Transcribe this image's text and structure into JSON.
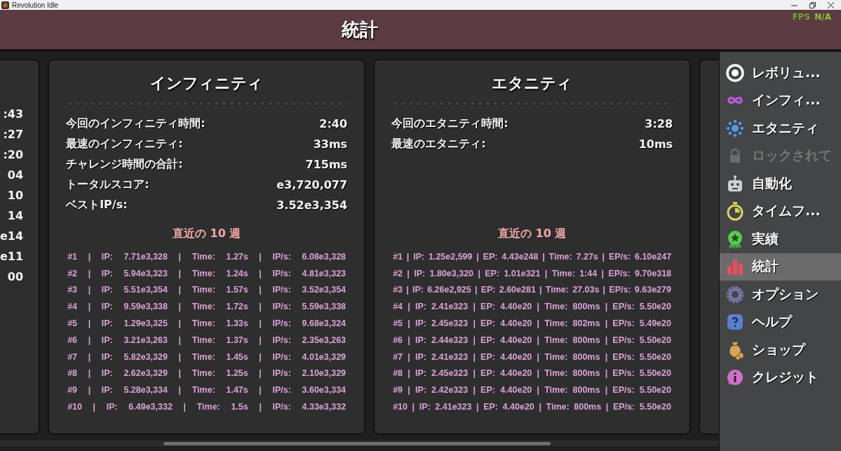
{
  "titlebar": {
    "title": "Revolution Idle"
  },
  "overlay": {
    "fps_label": "FPS",
    "fps_value": "N/A"
  },
  "header": {
    "title": "統計"
  },
  "partial_card": {
    "values": [
      ":43",
      ":27",
      ":20",
      "04",
      "10",
      "14",
      "e14",
      "e11",
      "00"
    ]
  },
  "cards": [
    {
      "title": "インフィニティ",
      "stats": [
        {
          "label": "今回のインフィニティ時間:",
          "value": "2:40"
        },
        {
          "label": "最速のインフィニティ:",
          "value": "33ms"
        },
        {
          "label": "チャレンジ時間の合計:",
          "value": "715ms"
        },
        {
          "label": "トータルスコア:",
          "value": "e3,720,077"
        },
        {
          "label": "ベストIP/s:",
          "value": "3.52e3,354"
        }
      ],
      "recent_heading": "直近の 10 週",
      "runs": [
        {
          "cells": [
            "#1",
            "|",
            "IP:",
            "7.71e3,328",
            "|",
            "Time:",
            "1.27s",
            "|",
            "IP/s:",
            "6.08e3,328"
          ]
        },
        {
          "cells": [
            "#2",
            "|",
            "IP:",
            "5.94e3,323",
            "|",
            "Time:",
            "1.24s",
            "|",
            "IP/s:",
            "4.81e3,323"
          ]
        },
        {
          "cells": [
            "#3",
            "|",
            "IP:",
            "5.51e3,354",
            "|",
            "Time:",
            "1.57s",
            "|",
            "IP/s:",
            "3.52e3,354"
          ]
        },
        {
          "cells": [
            "#4",
            "|",
            "IP:",
            "9.59e3,338",
            "|",
            "Time:",
            "1.72s",
            "|",
            "IP/s:",
            "5.59e3,338"
          ]
        },
        {
          "cells": [
            "#5",
            "|",
            "IP:",
            "1.29e3,325",
            "|",
            "Time:",
            "1.33s",
            "|",
            "IP/s:",
            "9.68e3,324"
          ]
        },
        {
          "cells": [
            "#6",
            "|",
            "IP:",
            "3.21e3,263",
            "|",
            "Time:",
            "1.37s",
            "|",
            "IP/s:",
            "2.35e3,263"
          ]
        },
        {
          "cells": [
            "#7",
            "|",
            "IP:",
            "5.82e3,329",
            "|",
            "Time:",
            "1.45s",
            "|",
            "IP/s:",
            "4.01e3,329"
          ]
        },
        {
          "cells": [
            "#8",
            "|",
            "IP:",
            "2.62e3,329",
            "|",
            "Time:",
            "1.25s",
            "|",
            "IP/s:",
            "2.10e3,329"
          ]
        },
        {
          "cells": [
            "#9",
            "|",
            "IP:",
            "5.28e3,334",
            "|",
            "Time:",
            "1.47s",
            "|",
            "IP/s:",
            "3.60e3,334"
          ]
        },
        {
          "cells": [
            "#10",
            "|",
            "IP:",
            "6.49e3,332",
            "|",
            "Time:",
            "1.5s",
            "|",
            "IP/s:",
            "4.33e3,332"
          ]
        }
      ]
    },
    {
      "title": "エタニティ",
      "stats": [
        {
          "label": "今回のエタニティ時間:",
          "value": "3:28"
        },
        {
          "label": "最速のエタニティ:",
          "value": "10ms"
        }
      ],
      "recent_heading": "直近の 10 週",
      "runs": [
        {
          "cells": [
            "#1",
            "|",
            "IP:",
            "1.25e2,599",
            "|",
            "EP:",
            "4.43e248",
            "|",
            "Time:",
            "7.27s",
            "|",
            "EP/s:",
            "6.10e247"
          ]
        },
        {
          "cells": [
            "#2",
            "|",
            "IP:",
            "1.80e3,320",
            "|",
            "EP:",
            "1.01e321",
            "|",
            "Time:",
            "1:44",
            "|",
            "EP/s:",
            "9.70e318"
          ]
        },
        {
          "cells": [
            "#3",
            "|",
            "IP:",
            "6.26e2,925",
            "|",
            "EP:",
            "2.60e281",
            "|",
            "Time:",
            "27.03s",
            "|",
            "EP/s:",
            "9.63e279"
          ]
        },
        {
          "cells": [
            "#4",
            "|",
            "IP:",
            "2.41e323",
            "|",
            "EP:",
            "4.40e20",
            "|",
            "Time:",
            "800ms",
            "|",
            "EP/s:",
            "5.50e20"
          ]
        },
        {
          "cells": [
            "#5",
            "|",
            "IP:",
            "2.45e323",
            "|",
            "EP:",
            "4.40e20",
            "|",
            "Time:",
            "802ms",
            "|",
            "EP/s:",
            "5.49e20"
          ]
        },
        {
          "cells": [
            "#6",
            "|",
            "IP:",
            "2.44e323",
            "|",
            "EP:",
            "4.40e20",
            "|",
            "Time:",
            "800ms",
            "|",
            "EP/s:",
            "5.50e20"
          ]
        },
        {
          "cells": [
            "#7",
            "|",
            "IP:",
            "2.41e323",
            "|",
            "EP:",
            "4.40e20",
            "|",
            "Time:",
            "800ms",
            "|",
            "EP/s:",
            "5.50e20"
          ]
        },
        {
          "cells": [
            "#8",
            "|",
            "IP:",
            "2.45e323",
            "|",
            "EP:",
            "4.40e20",
            "|",
            "Time:",
            "800ms",
            "|",
            "EP/s:",
            "5.50e20"
          ]
        },
        {
          "cells": [
            "#9",
            "|",
            "IP:",
            "2.42e323",
            "|",
            "EP:",
            "4.40e20",
            "|",
            "Time:",
            "800ms",
            "|",
            "EP/s:",
            "5.50e20"
          ]
        },
        {
          "cells": [
            "#10",
            "|",
            "IP:",
            "2.41e323",
            "|",
            "EP:",
            "4.40e20",
            "|",
            "Time:",
            "800ms",
            "|",
            "EP/s:",
            "5.50e20"
          ]
        }
      ]
    }
  ],
  "sidebar": {
    "items": [
      {
        "label": "レボリュ...",
        "kind": "target",
        "selected": false,
        "locked": false
      },
      {
        "label": "インフィ...",
        "kind": "infinity",
        "selected": false,
        "locked": false
      },
      {
        "label": "エタニティ",
        "kind": "dots",
        "selected": false,
        "locked": false
      },
      {
        "label": "ロックされて",
        "kind": "lock",
        "selected": false,
        "locked": true
      },
      {
        "label": "自動化",
        "kind": "robot",
        "selected": false,
        "locked": false
      },
      {
        "label": "タイムフ...",
        "kind": "stopwatch",
        "selected": false,
        "locked": false
      },
      {
        "label": "実績",
        "kind": "medal",
        "selected": false,
        "locked": false
      },
      {
        "label": "統計",
        "kind": "chart",
        "selected": true,
        "locked": false
      },
      {
        "label": "オプション",
        "kind": "gear",
        "selected": false,
        "locked": false
      },
      {
        "label": "ヘルプ",
        "kind": "help",
        "selected": false,
        "locked": false
      },
      {
        "label": "ショップ",
        "kind": "bag",
        "selected": false,
        "locked": false
      },
      {
        "label": "クレジット",
        "kind": "info",
        "selected": false,
        "locked": false
      }
    ]
  }
}
